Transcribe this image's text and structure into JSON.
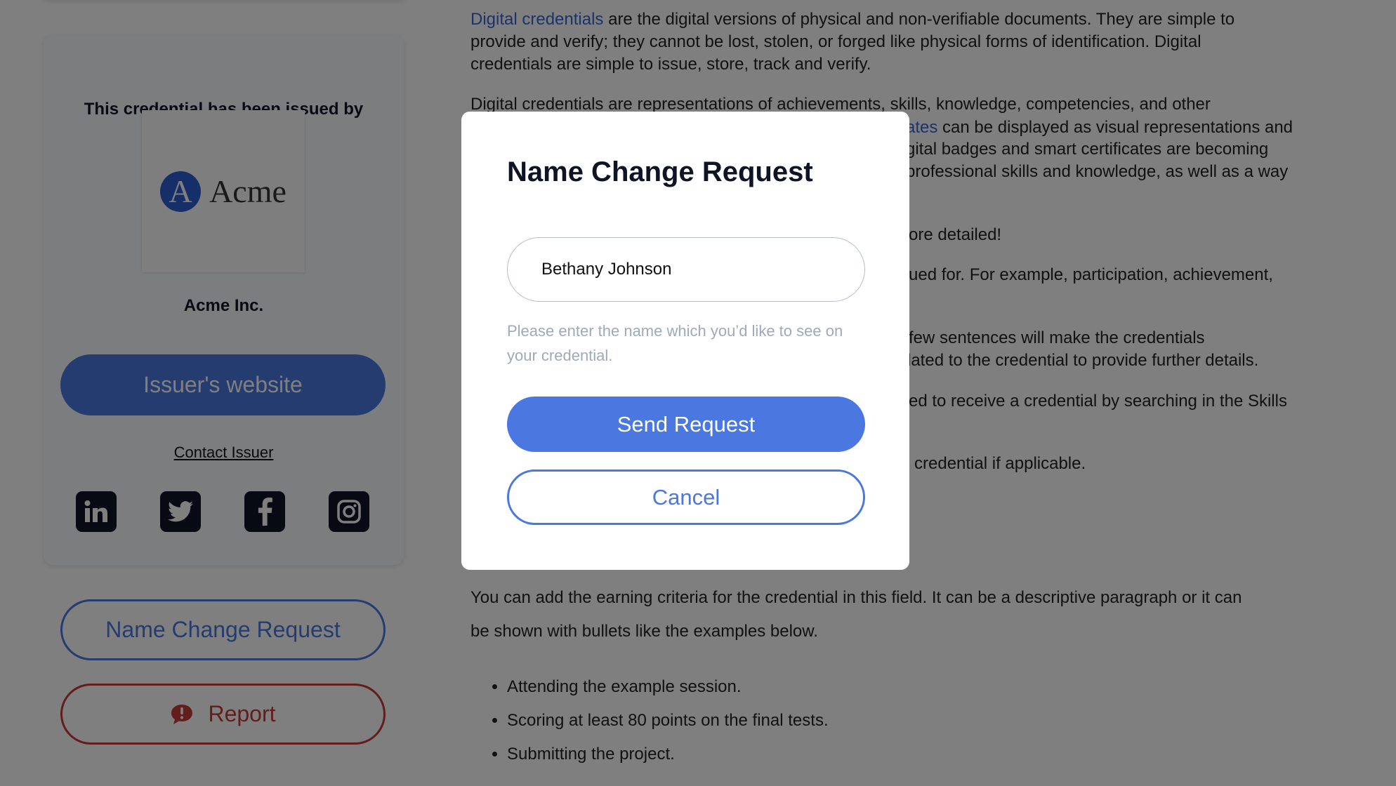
{
  "sidebar": {
    "issued_by_label": "This credential has been issued by",
    "logo_letter": "A",
    "logo_word": "Acme",
    "org_name": "Acme Inc.",
    "website_button": "Issuer's website",
    "contact_link": "Contact Issuer",
    "social_icons": [
      "linkedin-icon",
      "twitter-icon",
      "facebook-icon",
      "instagram-icon"
    ],
    "name_change_button": "Name Change Request",
    "report_button": "Report"
  },
  "main": {
    "p1_link": "Digital credentials",
    "p1_line1": " are the digital versions of physical and non-verifiable documents. They are simple to",
    "p1_line2": "provide and verify; they cannot be lost, stolen, or forged like physical forms of identification. Digital",
    "p1_line3": "credentials are simple to issue, store, track and verify.",
    "p2_line1": "Digital credentials are representations of achievements, skills, knowledge, competencies, and other",
    "fragments": {
      "f1_link": "ates",
      "f1": " can be displayed as visual representations and",
      "f2": "gital badges and smart certificates are becoming",
      "f3": "professional skills and knowledge, as well as a way",
      "f4": "ore detailed!",
      "f5": "ued for. For example, participation, achievement,",
      "f6": "few sentences will make the credentials",
      "f7": "lated to the credential to provide further details.",
      "f8": "ed to receive a credential by searching in the Skills",
      "f9": "credential if applicable."
    },
    "criteria_line1": "You can add the earning criteria for the credential in this field. It can be a descriptive paragraph or it can",
    "criteria_line2": "be shown with bullets like the examples below.",
    "bullets": [
      "Attending the example session.",
      "Scoring at least 80 points on the final tests.",
      "Submitting the project."
    ]
  },
  "modal": {
    "title": "Name Change Request",
    "name_value": "Bethany Johnson",
    "helper": "Please enter the name which you’d like to see on your credential.",
    "send_button": "Send Request",
    "cancel_button": "Cancel"
  },
  "colors": {
    "accent": "#4a78e0",
    "danger": "#c83a3a",
    "overlay": "rgba(0,0,0,0.5)"
  }
}
